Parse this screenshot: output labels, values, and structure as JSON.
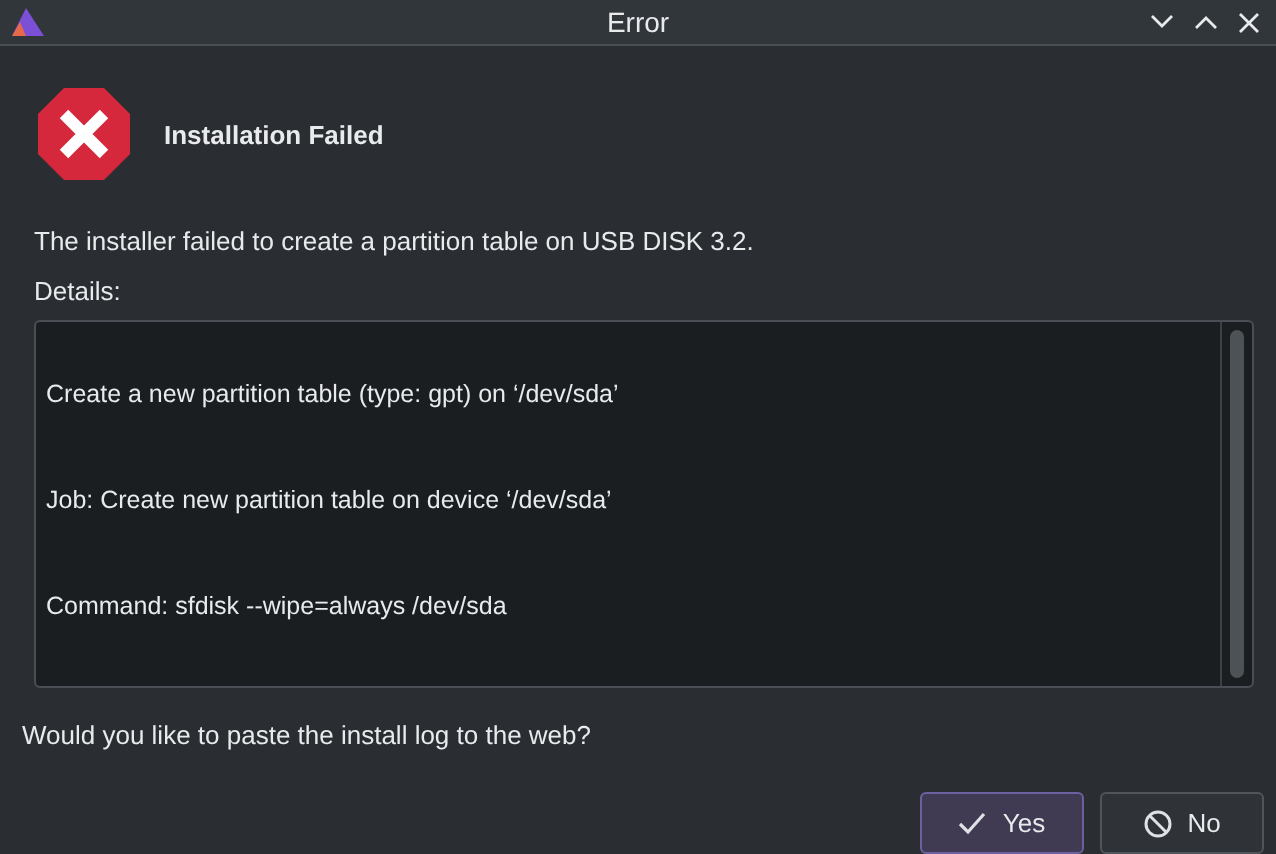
{
  "window": {
    "title": "Error"
  },
  "heading": "Installation Failed",
  "message": "The installer failed to create a partition table on USB DISK 3.2.",
  "details_label": "Details:",
  "details_lines": [
    "Create a new partition table (type: gpt) on ‘/dev/sda’",
    "Job: Create new partition table on device ‘/dev/sda’",
    "Command: sfdisk --wipe=always /dev/sda"
  ],
  "question": "Would you like to paste the install log to the web?",
  "buttons": [
    {
      "label": "Yes",
      "kind": "yes",
      "default": true
    },
    {
      "label": "No",
      "kind": "no",
      "default": false
    }
  ]
}
